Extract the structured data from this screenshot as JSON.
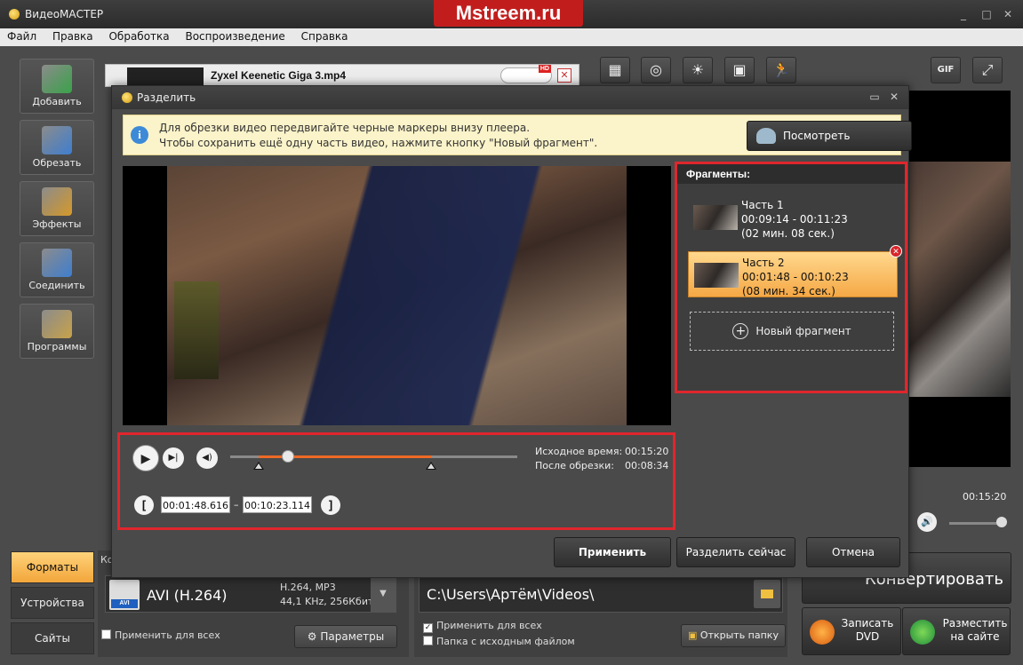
{
  "window": {
    "app_title": "ВидеоМАСТЕР",
    "watermark": "Mstreem.ru",
    "controls": [
      "_",
      "□",
      "✕"
    ]
  },
  "menu": [
    "Файл",
    "Правка",
    "Обработка",
    "Воспроизведение",
    "Справка"
  ],
  "left_toolbar": [
    {
      "label": "Добавить",
      "icon": "add-video-icon",
      "color": "#3aa34a"
    },
    {
      "label": "Обрезать",
      "icon": "scissors-icon",
      "color": "#3f7fd0"
    },
    {
      "label": "Эффекты",
      "icon": "effects-icon",
      "color": "#d69a2a"
    },
    {
      "label": "Соединить",
      "icon": "join-icon",
      "color": "#3f7fd0"
    },
    {
      "label": "Программы",
      "icon": "programs-icon",
      "color": "#c9a34a"
    }
  ],
  "side_tabs": [
    "Форматы",
    "Устройства",
    "Сайты"
  ],
  "file_strip": {
    "filename": "Zyxel Keenetic Giga 3.mp4",
    "hd_badge": "HD"
  },
  "top_tools": [
    {
      "icon": "crop-icon",
      "glyph": "▦"
    },
    {
      "icon": "rotate-icon",
      "glyph": "◎"
    },
    {
      "icon": "brightness-icon",
      "glyph": "☀"
    },
    {
      "icon": "frame-icon",
      "glyph": "▣"
    },
    {
      "icon": "speed-icon",
      "glyph": "🏃"
    },
    {
      "icon": "gif-icon",
      "glyph": "GIF"
    },
    {
      "icon": "fullscreen-icon",
      "glyph": "⤢"
    }
  ],
  "right_preview": {
    "time": "00:15:20"
  },
  "format": {
    "badge": "AVI",
    "name": "AVI (H.264)",
    "info_line1": "H.264, MP3",
    "info_line2": "44,1 KHz, 256Кбит",
    "apply_all": "Применить для всех",
    "params_button": "Параметры",
    "partial_label": "Ко"
  },
  "output": {
    "path": "C:\\Users\\Артём\\Videos\\",
    "apply_all": "Применить для всех",
    "same_folder": "Папка с исходным файлом",
    "open_folder": "Открыть папку",
    "apply_all_checked": true,
    "same_folder_checked": false
  },
  "actions": {
    "convert": "Конвертировать",
    "burn_dvd_line1": "Записать",
    "burn_dvd_line2": "DVD",
    "publish_line1": "Разместить",
    "publish_line2": "на сайте"
  },
  "dialog": {
    "title": "Разделить",
    "info_line1": "Для обрезки видео передвигайте черные маркеры внизу плеера.",
    "info_line2": "Чтобы сохранить ещё одну часть видео, нажмите кнопку \"Новый фрагмент\".",
    "tutorial_button": "Посмотреть видеоурок",
    "player": {
      "source_time_label": "Исходное время:",
      "source_time": "00:15:20",
      "after_trim_label": "После обрезки:",
      "after_trim": "00:08:34",
      "start_time": "00:01:48.616",
      "end_time": "00:10:23.114",
      "separator": "–",
      "bracket_start": "[",
      "bracket_end": "]",
      "playhead_fraction": 0.2,
      "selection_start_fraction": 0.1,
      "selection_end_fraction": 0.7
    },
    "fragments": {
      "header": "Фрагменты:",
      "items": [
        {
          "name": "Часть 1",
          "range": "00:09:14 - 00:11:23",
          "duration": "(02 мин. 08 сек.)",
          "selected": false
        },
        {
          "name": "Часть 2",
          "range": "00:01:48 - 00:10:23",
          "duration": "(08 мин. 34 сек.)",
          "selected": true
        }
      ],
      "new_fragment": "Новый фрагмент"
    },
    "buttons": {
      "apply": "Применить",
      "split_now": "Разделить сейчас",
      "cancel": "Отмена"
    }
  }
}
